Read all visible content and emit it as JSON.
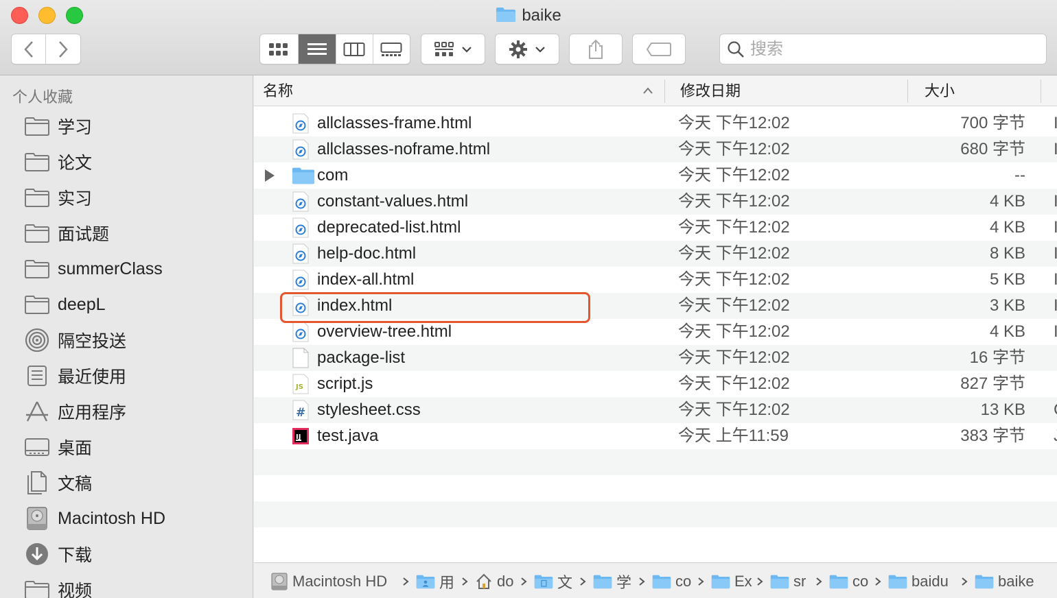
{
  "window": {
    "title": "baike"
  },
  "search": {
    "placeholder": "搜索",
    "value": ""
  },
  "sidebar": {
    "header": "个人收藏",
    "items": [
      {
        "label": "学习",
        "icon": "folder-icon"
      },
      {
        "label": "论文",
        "icon": "folder-icon"
      },
      {
        "label": "实习",
        "icon": "folder-icon"
      },
      {
        "label": "面试题",
        "icon": "folder-icon"
      },
      {
        "label": "summerClass",
        "icon": "folder-icon"
      },
      {
        "label": "deepL",
        "icon": "folder-icon"
      },
      {
        "label": "隔空投送",
        "icon": "airdrop-icon"
      },
      {
        "label": "最近使用",
        "icon": "recents-icon"
      },
      {
        "label": "应用程序",
        "icon": "applications-icon"
      },
      {
        "label": "桌面",
        "icon": "desktop-icon"
      },
      {
        "label": "文稿",
        "icon": "documents-icon"
      },
      {
        "label": "Macintosh HD",
        "icon": "harddisk-icon"
      },
      {
        "label": "下载",
        "icon": "downloads-icon"
      },
      {
        "label": "视频",
        "icon": "folder-icon"
      }
    ]
  },
  "columns": {
    "name": "名称",
    "date": "修改日期",
    "size": "大小"
  },
  "files": [
    {
      "name": "allclasses-frame.html",
      "date": "今天 下午12:02",
      "size": "700 字节",
      "edge": "I",
      "type": "html"
    },
    {
      "name": "allclasses-noframe.html",
      "date": "今天 下午12:02",
      "size": "680 字节",
      "edge": "I",
      "type": "html"
    },
    {
      "name": "com",
      "date": "今天 下午12:02",
      "size": "--",
      "edge": "",
      "type": "folder"
    },
    {
      "name": "constant-values.html",
      "date": "今天 下午12:02",
      "size": "4 KB",
      "edge": "I",
      "type": "html"
    },
    {
      "name": "deprecated-list.html",
      "date": "今天 下午12:02",
      "size": "4 KB",
      "edge": "I",
      "type": "html"
    },
    {
      "name": "help-doc.html",
      "date": "今天 下午12:02",
      "size": "8 KB",
      "edge": "I",
      "type": "html"
    },
    {
      "name": "index-all.html",
      "date": "今天 下午12:02",
      "size": "5 KB",
      "edge": "I",
      "type": "html"
    },
    {
      "name": "index.html",
      "date": "今天 下午12:02",
      "size": "3 KB",
      "edge": "I",
      "type": "html"
    },
    {
      "name": "overview-tree.html",
      "date": "今天 下午12:02",
      "size": "4 KB",
      "edge": "I",
      "type": "html"
    },
    {
      "name": "package-list",
      "date": "今天 下午12:02",
      "size": "16 字节",
      "edge": "",
      "type": "plain"
    },
    {
      "name": "script.js",
      "date": "今天 下午12:02",
      "size": "827 字节",
      "edge": "",
      "type": "js"
    },
    {
      "name": "stylesheet.css",
      "date": "今天 下午12:02",
      "size": "13 KB",
      "edge": "C",
      "type": "css"
    },
    {
      "name": "test.java",
      "date": "今天 上午11:59",
      "size": "383 字节",
      "edge": "J",
      "type": "java"
    }
  ],
  "path": [
    {
      "label": "Macintosh HD",
      "icon": "harddisk-icon"
    },
    {
      "label": "用",
      "icon": "user-folder-icon"
    },
    {
      "label": "do",
      "icon": "home-icon"
    },
    {
      "label": "文",
      "icon": "documents-folder-icon"
    },
    {
      "label": "学",
      "icon": "folder-icon"
    },
    {
      "label": "co",
      "icon": "folder-icon"
    },
    {
      "label": "Ex",
      "icon": "folder-icon"
    },
    {
      "label": "sr",
      "icon": "folder-icon"
    },
    {
      "label": "co",
      "icon": "folder-icon"
    },
    {
      "label": "baidu",
      "icon": "folder-icon"
    },
    {
      "label": "baike",
      "icon": "folder-icon"
    }
  ],
  "colors": {
    "accent": "#4aa3f0",
    "highlight_border": "#e4572e"
  }
}
